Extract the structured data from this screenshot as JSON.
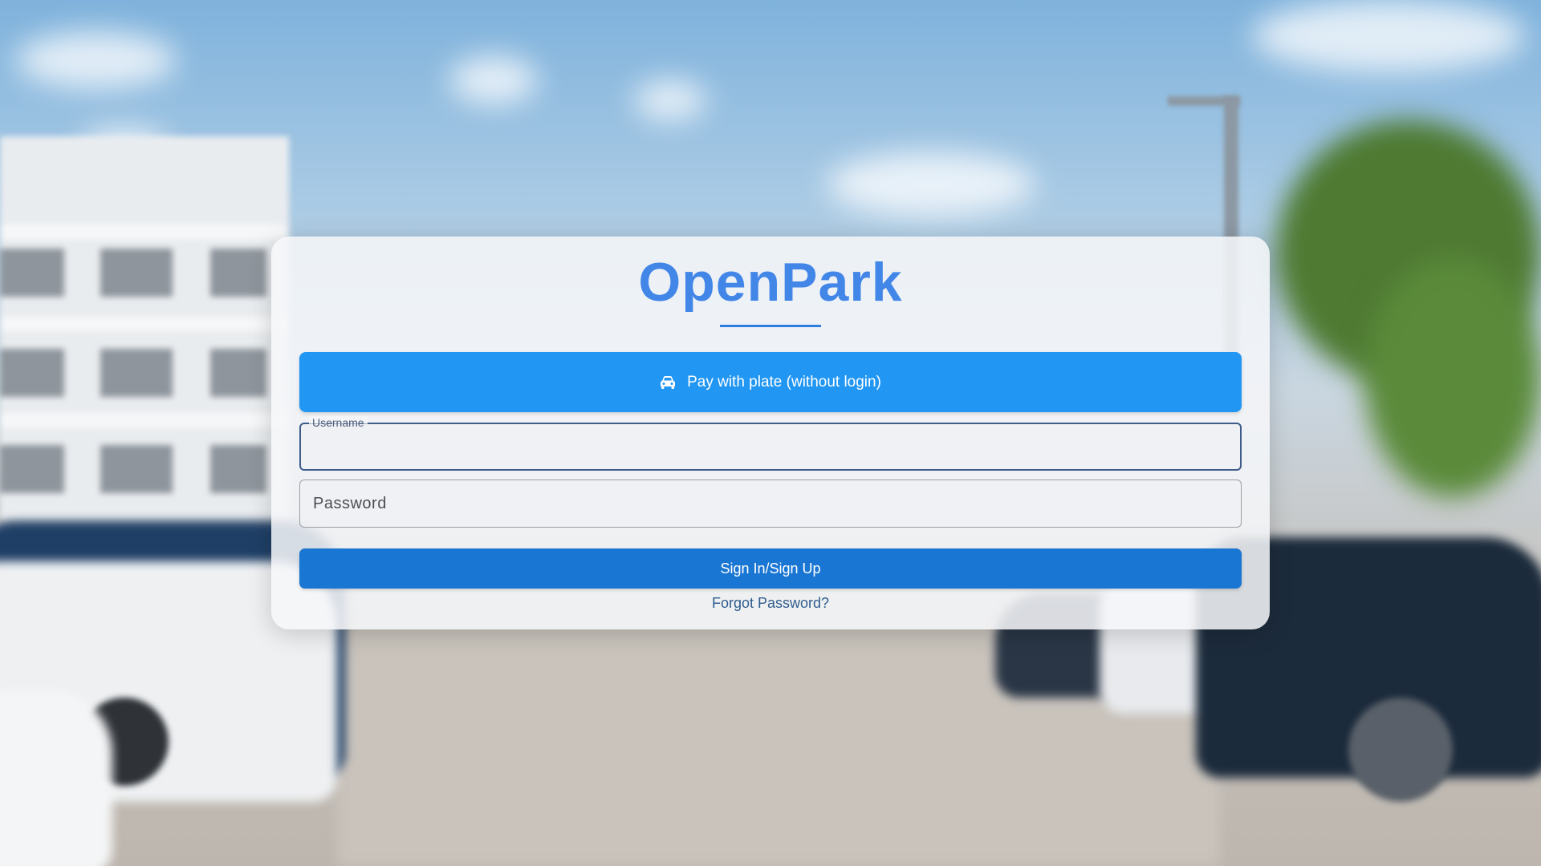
{
  "app": {
    "brand": "OpenPark"
  },
  "actions": {
    "pay_with_plate_label": "Pay with plate (without login)",
    "pay_icon": "car-icon",
    "sign_in_label": "Sign In/Sign Up",
    "forgot_password_label": "Forgot Password?"
  },
  "form": {
    "username": {
      "label": "Username",
      "value": ""
    },
    "password": {
      "placeholder": "Password",
      "value": ""
    }
  },
  "colors": {
    "brand": "#4286e8",
    "pay_button": "#2196f3",
    "sign_in_button": "#1976d2",
    "link": "#2f5d8f"
  },
  "background": {
    "description_icon": "parking-lot-photo"
  }
}
